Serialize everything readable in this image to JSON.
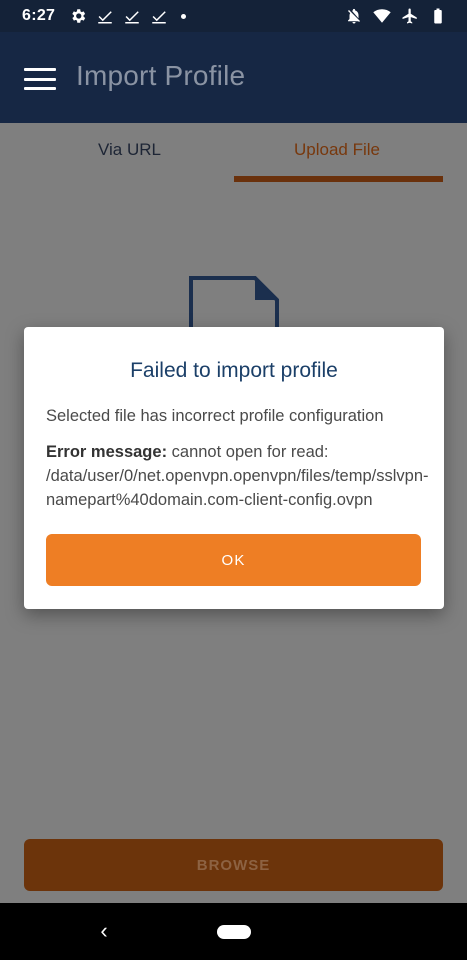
{
  "status_bar": {
    "time": "6:27",
    "left_icons": [
      "gear-icon",
      "check-icon",
      "check-icon",
      "check-icon",
      "dot-icon"
    ],
    "right_icons": [
      "bell-off-icon",
      "wifi-icon",
      "airplane-icon",
      "battery-icon"
    ]
  },
  "app_bar": {
    "title": "Import Profile",
    "menu_icon": "hamburger-menu-icon"
  },
  "tabs": [
    {
      "label": "Via URL",
      "selected": false
    },
    {
      "label": "Upload File",
      "selected": true
    }
  ],
  "content": {
    "file_icon": "file-icon",
    "browse_label": "BROWSE"
  },
  "dialog": {
    "title": "Failed to import profile",
    "message": "Selected file has incorrect profile configuration",
    "error_label": "Error message:",
    "error_text": " cannot open for read: /data/user/0/net.openvpn.openvpn/files/temp/sslvpn-namepart%40domain.com-client-config.ovpn",
    "ok_label": "OK"
  },
  "nav_bar": {
    "back_icon": "back-chevron-icon",
    "home_icon": "home-pill-icon"
  },
  "colors": {
    "accent": "#ee7e24",
    "app_bar": "#162744",
    "dialog_title": "#1b3f68"
  }
}
